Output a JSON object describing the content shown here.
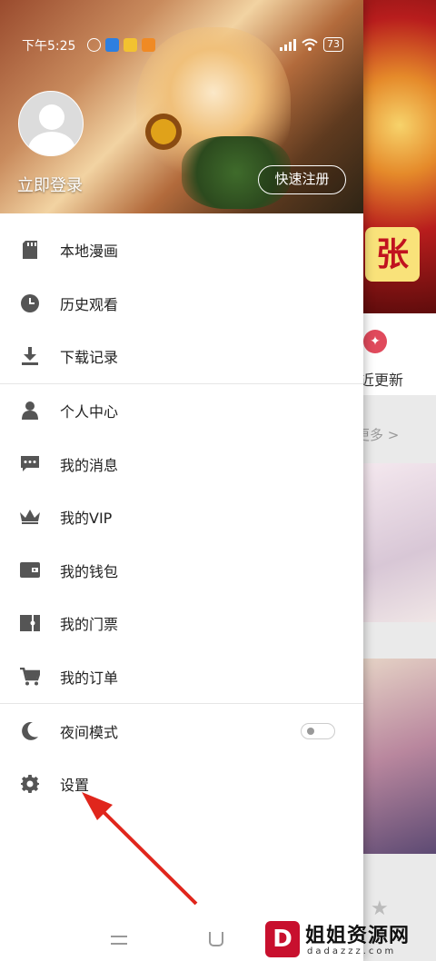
{
  "status_bar": {
    "time": "下午5:25",
    "battery": "73"
  },
  "header": {
    "login_label": "立即登录",
    "register_label": "快速注册"
  },
  "menu": {
    "local_comics": "本地漫画",
    "history": "历史观看",
    "downloads": "下载记录",
    "personal_center": "个人中心",
    "messages": "我的消息",
    "vip": "我的VIP",
    "wallet": "我的钱包",
    "tickets": "我的门票",
    "orders": "我的订单",
    "night_mode": "夜间模式",
    "settings": "设置"
  },
  "background_app": {
    "logo_text": "张",
    "update_label": "近更新",
    "more_label": "更多 >"
  },
  "watermark": {
    "mark": "D",
    "title": "姐姐资源网",
    "domain": "dadazzz.com"
  },
  "colors": {
    "accent_red": "#e0261c",
    "icon_gray": "#555555",
    "text": "#222222"
  },
  "icons": [
    "sd-card-icon",
    "clock-icon",
    "download-icon",
    "person-icon",
    "message-icon",
    "crown-icon",
    "wallet-icon",
    "ticket-icon",
    "cart-icon",
    "moon-icon",
    "gear-icon"
  ]
}
